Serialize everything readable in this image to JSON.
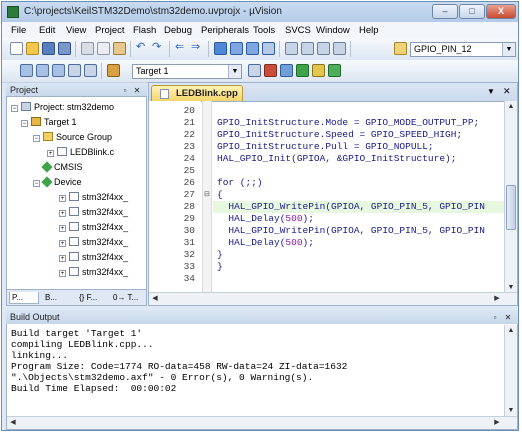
{
  "window": {
    "title": "C:\\projects\\KeilSTM32Demo\\stm32demo.uvprojx - µVision",
    "minimize": "–",
    "maximize": "□",
    "close": "X"
  },
  "menu": [
    "File",
    "Edit",
    "View",
    "Project",
    "Flash",
    "Debug",
    "Peripherals",
    "Tools",
    "SVCS",
    "Window",
    "Help"
  ],
  "toolbar1": {
    "find_value": "GPIO_PIN_12"
  },
  "toolbar2": {
    "target_value": "Target 1"
  },
  "project_panel": {
    "title": "Project",
    "tree": {
      "root": "Project: stm32demo",
      "target": "Target 1",
      "source_group": "Source Group",
      "file": "LEDBlink.c",
      "cmsis": "CMSIS",
      "device": "Device",
      "device_items": [
        "stm32f4xx_",
        "stm32f4xx_",
        "stm32f4xx_",
        "stm32f4xx_",
        "stm32f4xx_",
        "stm32f4xx_"
      ]
    },
    "tabs": [
      "P...",
      "B...",
      "{} F...",
      "0→ T..."
    ]
  },
  "editor": {
    "tab_label": "LEDBlink.cpp",
    "lines": [
      {
        "n": "20",
        "code": ""
      },
      {
        "n": "21",
        "code": "GPIO_InitStructure.Mode = GPIO_MODE_OUTPUT_PP;"
      },
      {
        "n": "22",
        "code": "GPIO_InitStructure.Speed = GPIO_SPEED_HIGH;"
      },
      {
        "n": "23",
        "code": "GPIO_InitStructure.Pull = GPIO_NOPULL;"
      },
      {
        "n": "24",
        "code": "HAL_GPIO_Init(GPIOA, &GPIO_InitStructure);"
      },
      {
        "n": "25",
        "code": ""
      },
      {
        "n": "26",
        "code": "for (;;)"
      },
      {
        "n": "27",
        "code": "{"
      },
      {
        "n": "28",
        "code": "  HAL_GPIO_WritePin(GPIOA, GPIO_PIN_5, GPIO_PIN"
      },
      {
        "n": "29",
        "code": "  HAL_Delay(500);"
      },
      {
        "n": "30",
        "code": "  HAL_GPIO_WritePin(GPIOA, GPIO_PIN_5, GPIO_PIN"
      },
      {
        "n": "31",
        "code": "  HAL_Delay(500);"
      },
      {
        "n": "32",
        "code": "}"
      },
      {
        "n": "33",
        "code": "}"
      },
      {
        "n": "34",
        "code": ""
      }
    ],
    "highlighted_line": "28"
  },
  "output_panel": {
    "title": "Build Output",
    "lines": [
      "Build target 'Target 1'",
      "compiling LEDBlink.cpp...",
      "linking...",
      "Program Size: Code=1774 RO-data=458 RW-data=24 ZI-data=1632",
      "\".\\Objects\\stm32demo.axf\" - 0 Error(s), 0 Warning(s).",
      "Build Time Elapsed:  00:00:02"
    ]
  },
  "colors": {
    "titlebar": "#b3cbe9",
    "highlight_line": "#e8f8e0",
    "code_text": "#1a1a8a"
  }
}
